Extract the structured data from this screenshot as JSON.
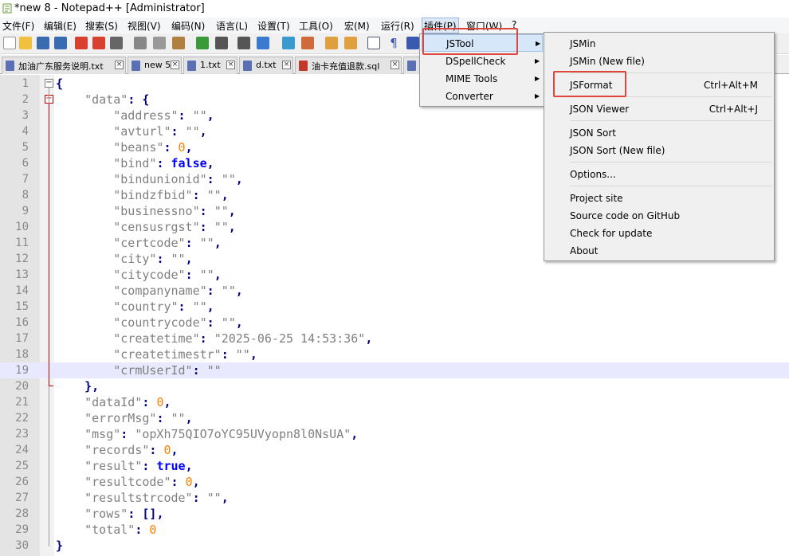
{
  "window": {
    "title": "*new 8 - Notepad++ [Administrator]"
  },
  "menubar": {
    "items": [
      "文件(F)",
      "编辑(E)",
      "搜索(S)",
      "视图(V)",
      "编码(N)",
      "语言(L)",
      "设置(T)",
      "工具(O)",
      "宏(M)",
      "运行(R)",
      "插件(P)",
      "窗口(W)",
      "?"
    ]
  },
  "tabs": [
    {
      "label": "加油广东服务说明.txt",
      "icon": "doc-icon"
    },
    {
      "label": "new 5",
      "icon": "doc-icon"
    },
    {
      "label": "1.txt",
      "icon": "doc-icon"
    },
    {
      "label": "d.txt",
      "icon": "doc-icon"
    },
    {
      "label": "油卡充值退款.sql",
      "icon": "doc-icon"
    }
  ],
  "plugins_menu": {
    "items": [
      "JSTool",
      "DSpellCheck",
      "MIME Tools",
      "Converter"
    ]
  },
  "jstool_menu": {
    "jsmin": "JSMin",
    "jsmin_new": "JSMin (New file)",
    "jsformat": "JSFormat",
    "jsformat_shortcut": "Ctrl+Alt+M",
    "json_viewer": "JSON Viewer",
    "json_viewer_shortcut": "Ctrl+Alt+J",
    "json_sort": "JSON Sort",
    "json_sort_new": "JSON Sort (New file)",
    "options": "Options...",
    "project_site": "Project site",
    "source_code": "Source code on GitHub",
    "check_update": "Check for update",
    "about": "About"
  },
  "editor": {
    "current_line": 19,
    "lines": [
      "{",
      "    \"data\": {",
      "        \"address\": \"\",",
      "        \"avturl\": \"\",",
      "        \"beans\": 0,",
      "        \"bind\": false,",
      "        \"bindunionid\": \"\",",
      "        \"bindzfbid\": \"\",",
      "        \"businessno\": \"\",",
      "        \"censusrgst\": \"\",",
      "        \"certcode\": \"\",",
      "        \"city\": \"\",",
      "        \"citycode\": \"\",",
      "        \"companyname\": \"\",",
      "        \"country\": \"\",",
      "        \"countrycode\": \"\",",
      "        \"createtime\": \"2025-06-25 14:53:36\",",
      "        \"createtimestr\": \"\",",
      "        \"crmUserId\": \"\"",
      "    },",
      "    \"dataId\": 0,",
      "    \"errorMsg\": \"\",",
      "    \"msg\": \"opXh75QIO7oYC95UVyopn8l0NsUA\",",
      "    \"records\": 0,",
      "    \"result\": true,",
      "    \"resultcode\": 0,",
      "    \"resultstrcode\": \"\",",
      "    \"rows\": [],",
      "    \"total\": 0",
      "}"
    ]
  }
}
